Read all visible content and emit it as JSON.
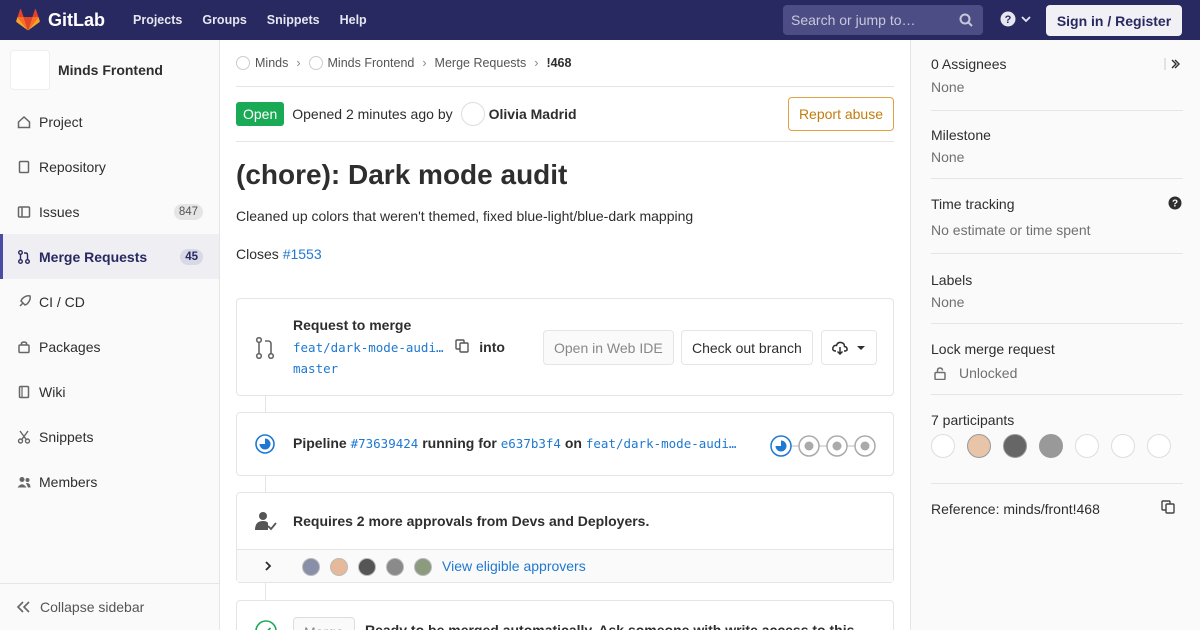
{
  "topbar": {
    "brand": "GitLab",
    "nav": [
      "Projects",
      "Groups",
      "Snippets",
      "Help"
    ],
    "search_placeholder": "Search or jump to…",
    "signin_label": "Sign in / Register",
    "colors": {
      "bg": "#292961",
      "brand_orange": "#e24329"
    }
  },
  "sidebar": {
    "project_name": "Minds Frontend",
    "items": [
      {
        "label": "Project",
        "icon": "home-icon"
      },
      {
        "label": "Repository",
        "icon": "doc-icon"
      },
      {
        "label": "Issues",
        "icon": "issues-icon",
        "count": "847"
      },
      {
        "label": "Merge Requests",
        "icon": "merge-request-icon",
        "count": "45",
        "active": true
      },
      {
        "label": "CI / CD",
        "icon": "rocket-icon"
      },
      {
        "label": "Packages",
        "icon": "package-icon"
      },
      {
        "label": "Wiki",
        "icon": "book-icon"
      },
      {
        "label": "Snippets",
        "icon": "scissors-icon"
      },
      {
        "label": "Members",
        "icon": "users-icon"
      }
    ],
    "collapse_label": "Collapse sidebar"
  },
  "breadcrumb": [
    "Minds",
    "Minds Frontend",
    "Merge Requests",
    "!468"
  ],
  "mr": {
    "state": "Open",
    "opened_prefix": "Opened",
    "opened_time": "2 minutes ago",
    "by": "by",
    "author": "Olivia Madrid",
    "report_label": "Report abuse",
    "title": "(chore): Dark mode audit",
    "description": "Cleaned up colors that weren't themed, fixed blue-light/blue-dark mapping",
    "closes_label": "Closes",
    "closes_issue": "#1553"
  },
  "merge_widget": {
    "heading": "Request to merge",
    "source_branch": "feat/dark-mode-audi…",
    "into": "into",
    "target_branch": "master",
    "web_ide_label": "Open in Web IDE",
    "checkout_label": "Check out branch"
  },
  "pipeline": {
    "label": "Pipeline",
    "id": "#73639424",
    "status_text": "running for",
    "commit": "e637b3f4",
    "on": "on",
    "branch": "feat/dark-mode-audi…"
  },
  "approvals": {
    "text": "Requires 2 more approvals from Devs and Deployers.",
    "view_label": "View eligible approvers"
  },
  "merge_footer": {
    "button_label": "Merge",
    "text": "Ready to be merged automatically. Ask someone with write access to this"
  },
  "right_sidebar": {
    "assignees_heading": "0 Assignees",
    "assignees_value": "None",
    "milestone_heading": "Milestone",
    "milestone_value": "None",
    "time_heading": "Time tracking",
    "time_value": "No estimate or time spent",
    "labels_heading": "Labels",
    "labels_value": "None",
    "lock_heading": "Lock merge request",
    "lock_value": "Unlocked",
    "participants_heading": "7 participants",
    "reference": "Reference: minds/front!468"
  }
}
